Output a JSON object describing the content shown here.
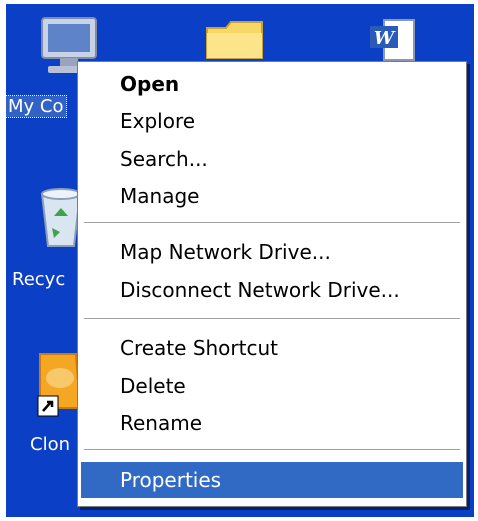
{
  "desktop": {
    "background": "#0a3fc6",
    "icons": [
      {
        "name": "my-computer-icon",
        "label": "My Co",
        "selected": true
      },
      {
        "name": "folder-icon",
        "label": ""
      },
      {
        "name": "word-document-icon",
        "label": ""
      },
      {
        "name": "recycle-bin-icon",
        "label": "Recyc"
      },
      {
        "name": "clone-shortcut-icon",
        "label": "Clon"
      }
    ]
  },
  "context_menu": {
    "groups": [
      [
        "Open",
        "Explore",
        "Search...",
        "Manage"
      ],
      [
        "Map Network Drive...",
        "Disconnect Network Drive..."
      ],
      [
        "Create Shortcut",
        "Delete",
        "Rename"
      ],
      [
        "Properties"
      ]
    ],
    "default_item": "Open",
    "highlighted_item": "Properties",
    "highlight_color": "#316ac5"
  }
}
